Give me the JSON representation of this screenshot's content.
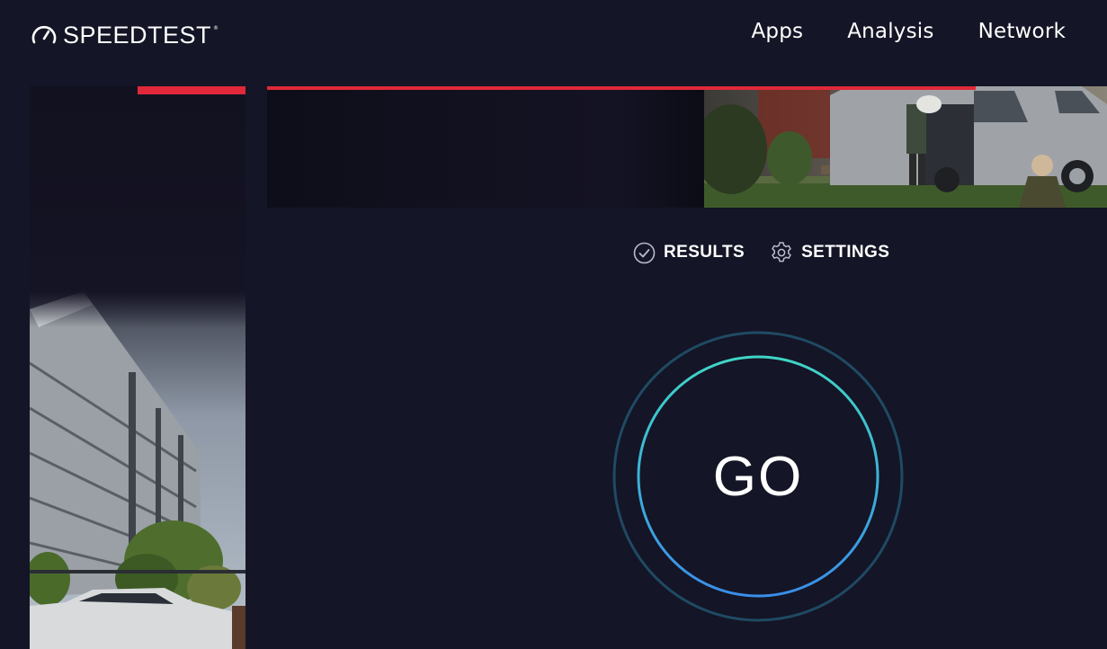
{
  "header": {
    "logo_text": "SPEEDTEST",
    "logo_tm": "®",
    "nav": [
      {
        "label": "Apps"
      },
      {
        "label": "Analysis"
      },
      {
        "label": "Network"
      }
    ]
  },
  "controls": {
    "results_label": "RESULTS",
    "settings_label": "SETTINGS"
  },
  "go_button": {
    "label": "GO"
  },
  "colors": {
    "background": "#141526",
    "accent_red": "#e0283a",
    "ring_outer": "#1f4a63",
    "ring_inner_start": "#3fd6c6",
    "ring_inner_end": "#3a8ee8"
  },
  "icons": [
    "speedometer-icon",
    "checkmark-circle-icon",
    "gear-icon"
  ]
}
